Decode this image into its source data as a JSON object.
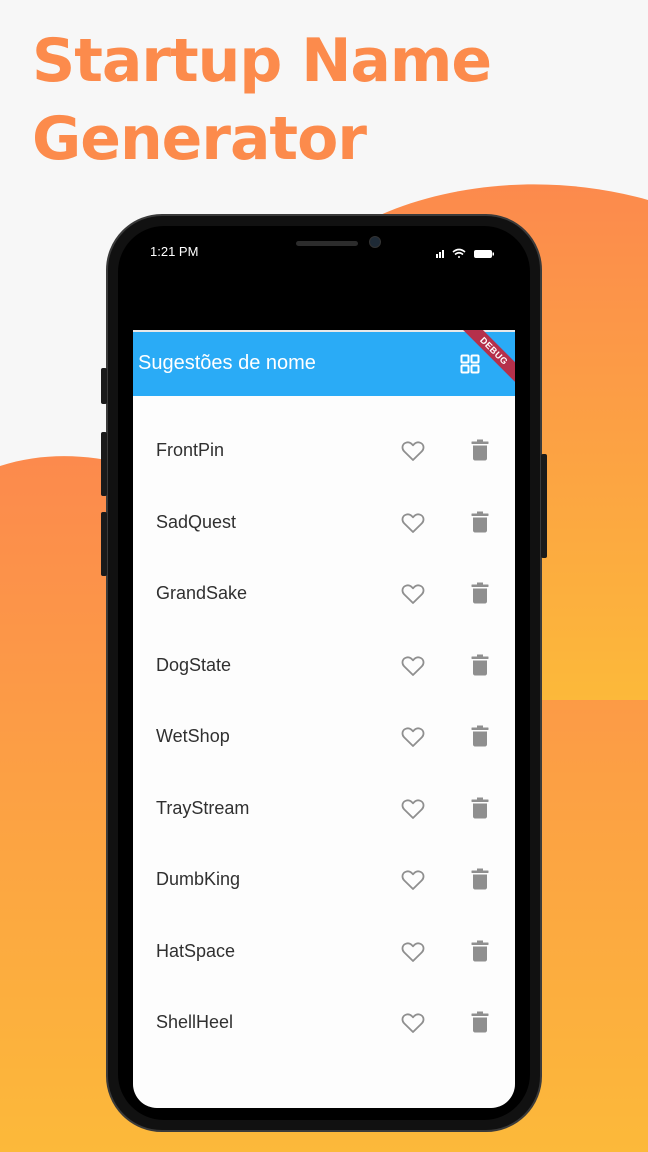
{
  "promo": {
    "headline_line1": "Startup Name",
    "headline_line2": "Generator",
    "accent_color": "#fc8b4c",
    "gradient_top": "#fc8a4d",
    "gradient_bottom": "#fcb93a"
  },
  "status_bar": {
    "time": "1:21 PM",
    "icons": [
      "signal-icon",
      "wifi-icon",
      "battery-icon"
    ]
  },
  "app_bar": {
    "title": "Sugestões de nome",
    "action_icon": "grid-view-icon",
    "debug_banner": "DEBUG",
    "color": "#2aabf6"
  },
  "suggestions": [
    {
      "name": "FrontPin",
      "favorite": false
    },
    {
      "name": "SadQuest",
      "favorite": false
    },
    {
      "name": "GrandSake",
      "favorite": false
    },
    {
      "name": "DogState",
      "favorite": false
    },
    {
      "name": "WetShop",
      "favorite": false
    },
    {
      "name": "TrayStream",
      "favorite": false
    },
    {
      "name": "DumbKing",
      "favorite": false
    },
    {
      "name": "HatSpace",
      "favorite": false
    },
    {
      "name": "ShellHeel",
      "favorite": false
    }
  ]
}
